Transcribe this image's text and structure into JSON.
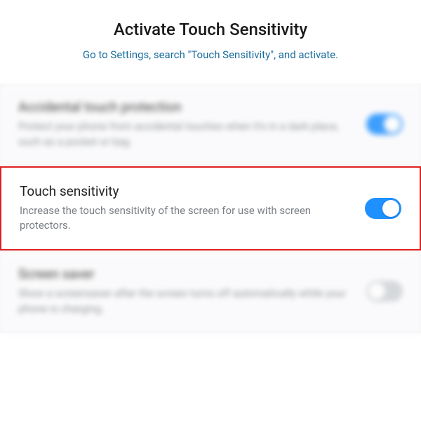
{
  "header": {
    "title": "Activate Touch Sensitivity",
    "subtitle": "Go to Settings, search \"Touch Sensitivity\", and activate."
  },
  "settings": {
    "accidental": {
      "title": "Accidental touch protection",
      "desc": "Protect your phone from accidental touches when it's in a dark place, such as a pocket or bag.",
      "on": true
    },
    "touch_sensitivity": {
      "title": "Touch sensitivity",
      "desc": "Increase the touch sensitivity of the screen for use with screen protectors.",
      "on": true
    },
    "screen_saver": {
      "title": "Screen saver",
      "desc": "Show a screensaver after the screen turns off automatically while your phone is charging.",
      "on": false
    }
  },
  "colors": {
    "accent": "#1e90ff",
    "highlight_border": "#e02020",
    "subtitle_text": "#1a6d9e"
  }
}
